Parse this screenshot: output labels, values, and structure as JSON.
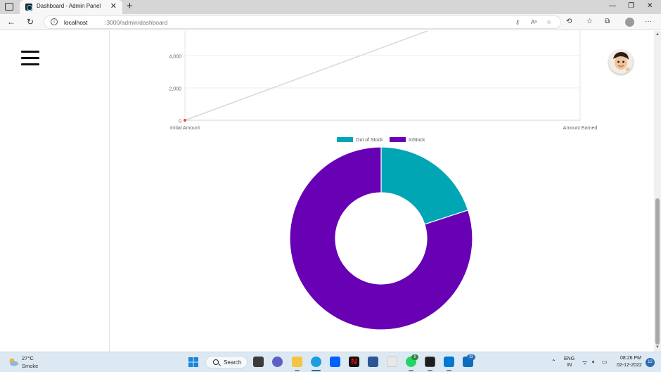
{
  "browser": {
    "tab_title": "Dashboard - Admin Panel",
    "tab_close": "✕",
    "new_tab": "+",
    "url_host": "localhost",
    "url_path": ":3000/admin/dashboard"
  },
  "line_chart": {
    "y_ticks": [
      "4,000",
      "2,000",
      "0"
    ],
    "x_labels": [
      "Initial Amount",
      "Amount Earned"
    ]
  },
  "chart_data": [
    {
      "type": "line",
      "categories": [
        "Initial Amount",
        "Amount Earned"
      ],
      "series": [
        {
          "values": [
            0,
            9000
          ],
          "color": "#d8d8d8",
          "point_color": "#ff3b3b"
        }
      ],
      "ylim": [
        0,
        4600
      ],
      "y_ticks": [
        0,
        2000,
        4000
      ],
      "grid": true
    },
    {
      "type": "pie",
      "donut": true,
      "legend_position": "top",
      "labels": [
        "Out of Stock",
        "InStock"
      ],
      "values": [
        20,
        80
      ],
      "colors": [
        "#00a6b4",
        "#6800b4"
      ]
    }
  ],
  "doughnut_legend": {
    "items": [
      {
        "label": "Out of Stock",
        "color": "#00a6b4"
      },
      {
        "label": "InStock",
        "color": "#6800b4"
      }
    ]
  },
  "taskbar": {
    "weather_temp": "27°C",
    "weather_desc": "Smoke",
    "search_label": "Search",
    "whatsapp_badge": "5",
    "mail_badge": "23",
    "lang_top": "ENG",
    "lang_bottom": "IN",
    "time": "08:26 PM",
    "date": "02-12-2022",
    "notification_count": "12"
  }
}
